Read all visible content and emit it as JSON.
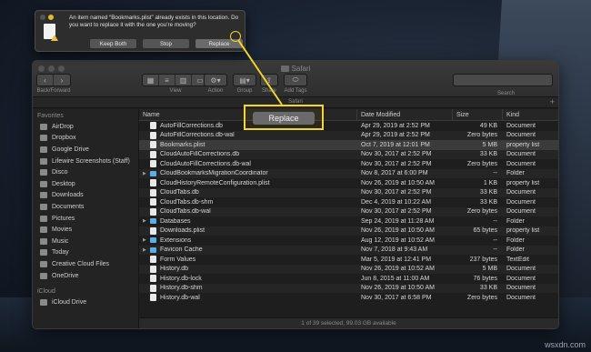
{
  "alert": {
    "message": "An item named “Bookmarks.plist” already exists in this location. Do you want to replace it with the one you’re moving?",
    "buttons": {
      "keep_both": "Keep Both",
      "stop": "Stop",
      "replace": "Replace"
    }
  },
  "callout": {
    "label": "Replace",
    "color": "#f2d629"
  },
  "window": {
    "title": "Safari",
    "tab_title": "Safari",
    "toolbar": {
      "back_forward": "Back/Forward",
      "view": "View",
      "action": "Action",
      "group": "Group",
      "share": "Share",
      "add_tags": "Add Tags",
      "search": "Search"
    }
  },
  "sidebar": {
    "favorites_header": "Favorites",
    "favorites": [
      "AirDrop",
      "Dropbox",
      "Google Drive",
      "Lifewire Screenshots (Staff)",
      "Disco",
      "Desktop",
      "Downloads",
      "Documents",
      "Pictures",
      "Movies",
      "Music",
      "Today",
      "Creative Cloud Files",
      "OneDrive"
    ],
    "icloud_header": "iCloud",
    "icloud": [
      "iCloud Drive"
    ]
  },
  "columns": {
    "name": "Name",
    "date": "Date Modified",
    "size": "Size",
    "kind": "Kind"
  },
  "files": [
    {
      "name": "AutoFillCorrections.db",
      "date": "Apr 29, 2019 at 2:52 PM",
      "size": "49 KB",
      "kind": "Document",
      "type": "file"
    },
    {
      "name": "AutoFillCorrections.db-wal",
      "date": "Apr 29, 2019 at 2:52 PM",
      "size": "Zero bytes",
      "kind": "Document",
      "type": "file"
    },
    {
      "name": "Bookmarks.plist",
      "date": "Oct 7, 2019 at 12:01 PM",
      "size": "5 MB",
      "kind": "property list",
      "type": "file",
      "selected": true
    },
    {
      "name": "CloudAutoFillCorrections.db",
      "date": "Nov 30, 2017 at 2:52 PM",
      "size": "33 KB",
      "kind": "Document",
      "type": "file"
    },
    {
      "name": "CloudAutoFillCorrections.db-wal",
      "date": "Nov 30, 2017 at 2:52 PM",
      "size": "Zero bytes",
      "kind": "Document",
      "type": "file"
    },
    {
      "name": "CloudBookmarksMigrationCoordinator",
      "date": "Nov 8, 2017 at 6:00 PM",
      "size": "--",
      "kind": "Folder",
      "type": "folder"
    },
    {
      "name": "CloudHistoryRemoteConfiguration.plist",
      "date": "Nov 26, 2019 at 10:50 AM",
      "size": "1 KB",
      "kind": "property list",
      "type": "file"
    },
    {
      "name": "CloudTabs.db",
      "date": "Nov 30, 2017 at 2:52 PM",
      "size": "33 KB",
      "kind": "Document",
      "type": "file"
    },
    {
      "name": "CloudTabs.db-shm",
      "date": "Dec 4, 2019 at 10:22 AM",
      "size": "33 KB",
      "kind": "Document",
      "type": "file"
    },
    {
      "name": "CloudTabs.db-wal",
      "date": "Nov 30, 2017 at 2:52 PM",
      "size": "Zero bytes",
      "kind": "Document",
      "type": "file"
    },
    {
      "name": "Databases",
      "date": "Sep 24, 2019 at 11:28 AM",
      "size": "--",
      "kind": "Folder",
      "type": "folder"
    },
    {
      "name": "Downloads.plist",
      "date": "Nov 26, 2019 at 10:50 AM",
      "size": "65 bytes",
      "kind": "property list",
      "type": "file"
    },
    {
      "name": "Extensions",
      "date": "Aug 12, 2019 at 10:52 AM",
      "size": "--",
      "kind": "Folder",
      "type": "folder"
    },
    {
      "name": "Favicon Cache",
      "date": "Nov 7, 2018 at 9:43 AM",
      "size": "--",
      "kind": "Folder",
      "type": "folder"
    },
    {
      "name": "Form Values",
      "date": "Mar 5, 2019 at 12:41 PM",
      "size": "237 bytes",
      "kind": "TextEdit",
      "type": "file"
    },
    {
      "name": "History.db",
      "date": "Nov 26, 2019 at 10:52 AM",
      "size": "5 MB",
      "kind": "Document",
      "type": "file"
    },
    {
      "name": "History.db-lock",
      "date": "Jun 8, 2015 at 11:00 AM",
      "size": "76 bytes",
      "kind": "Document",
      "type": "file"
    },
    {
      "name": "History.db-shm",
      "date": "Nov 26, 2019 at 10:50 AM",
      "size": "33 KB",
      "kind": "Document",
      "type": "file"
    },
    {
      "name": "History.db-wal",
      "date": "Nov 30, 2017 at 6:58 PM",
      "size": "Zero bytes",
      "kind": "Document",
      "type": "file"
    }
  ],
  "status": "1 of 39 selected, 99.03 GB available",
  "watermark": "wsxdn.com"
}
